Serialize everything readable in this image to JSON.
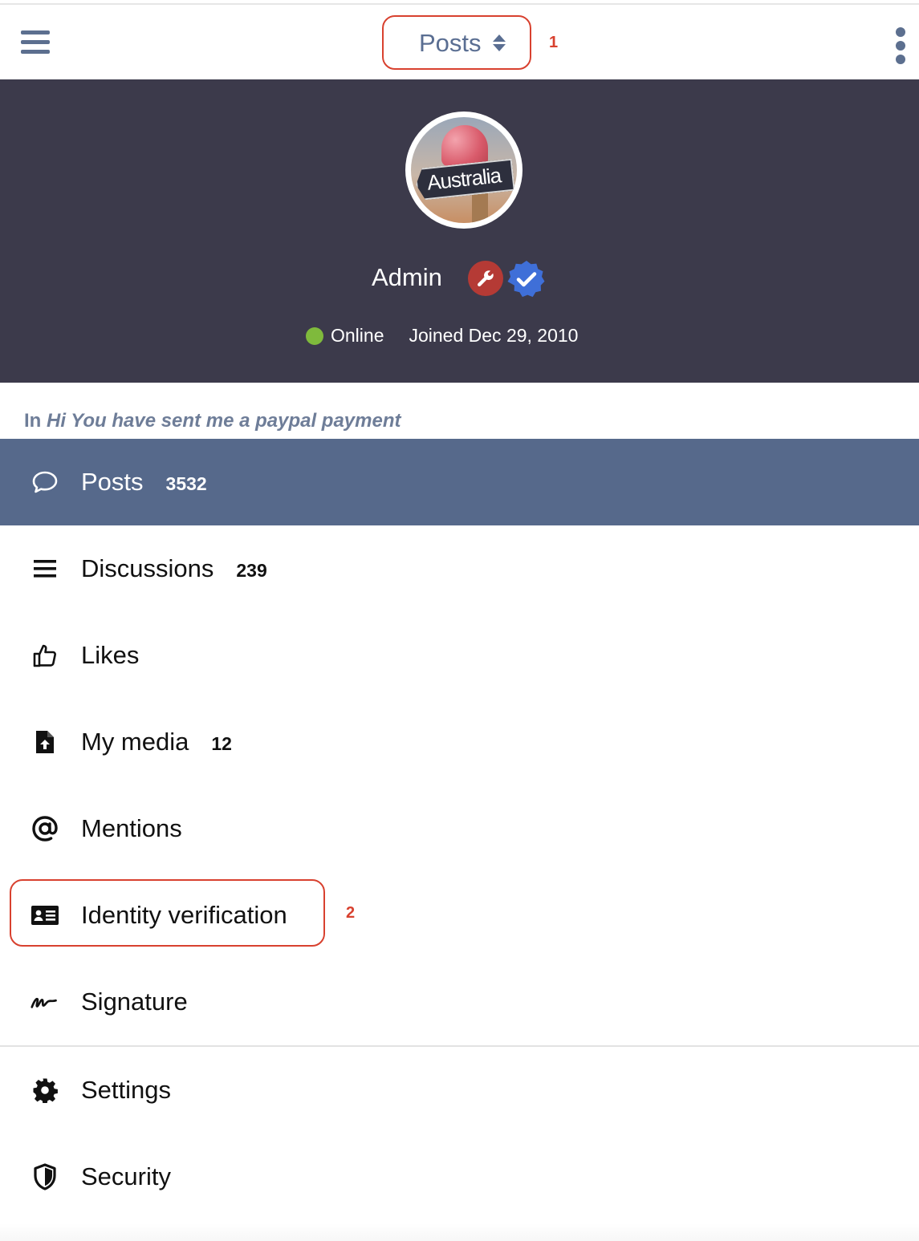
{
  "topbar": {
    "title": "Posts",
    "menu_icon": "hamburger-icon",
    "more_icon": "kebab-icon",
    "annotation_1": "1"
  },
  "profile": {
    "avatar_text": "Australia",
    "username": "Admin",
    "status": "Online",
    "joined": "Joined Dec 29, 2010",
    "badges": [
      "wrench-icon",
      "verified-badge-icon"
    ],
    "colors": {
      "header_bg": "#3c3a4b",
      "online_dot": "#7fba3c",
      "mod_badge": "#b53a35",
      "verified_badge": "#3f6fd8"
    }
  },
  "last_post": {
    "prefix": "In",
    "thread": "Hi You have sent me a paypal payment"
  },
  "menu": {
    "items": [
      {
        "label": "Posts",
        "count": "3532",
        "icon": "speech-bubble-icon",
        "active": true
      },
      {
        "label": "Discussions",
        "count": "239",
        "icon": "list-icon"
      },
      {
        "label": "Likes",
        "count": "",
        "icon": "thumbs-up-icon"
      },
      {
        "label": "My media",
        "count": "12",
        "icon": "file-upload-icon"
      },
      {
        "label": "Mentions",
        "count": "",
        "icon": "at-sign-icon"
      },
      {
        "label": "Identity verification",
        "count": "",
        "icon": "id-card-icon"
      },
      {
        "label": "Signature",
        "count": "",
        "icon": "signature-icon"
      },
      {
        "label": "Settings",
        "count": "",
        "icon": "gear-icon"
      },
      {
        "label": "Security",
        "count": "",
        "icon": "shield-icon"
      }
    ],
    "annotation_2": "2",
    "active_color": "#56698b"
  }
}
